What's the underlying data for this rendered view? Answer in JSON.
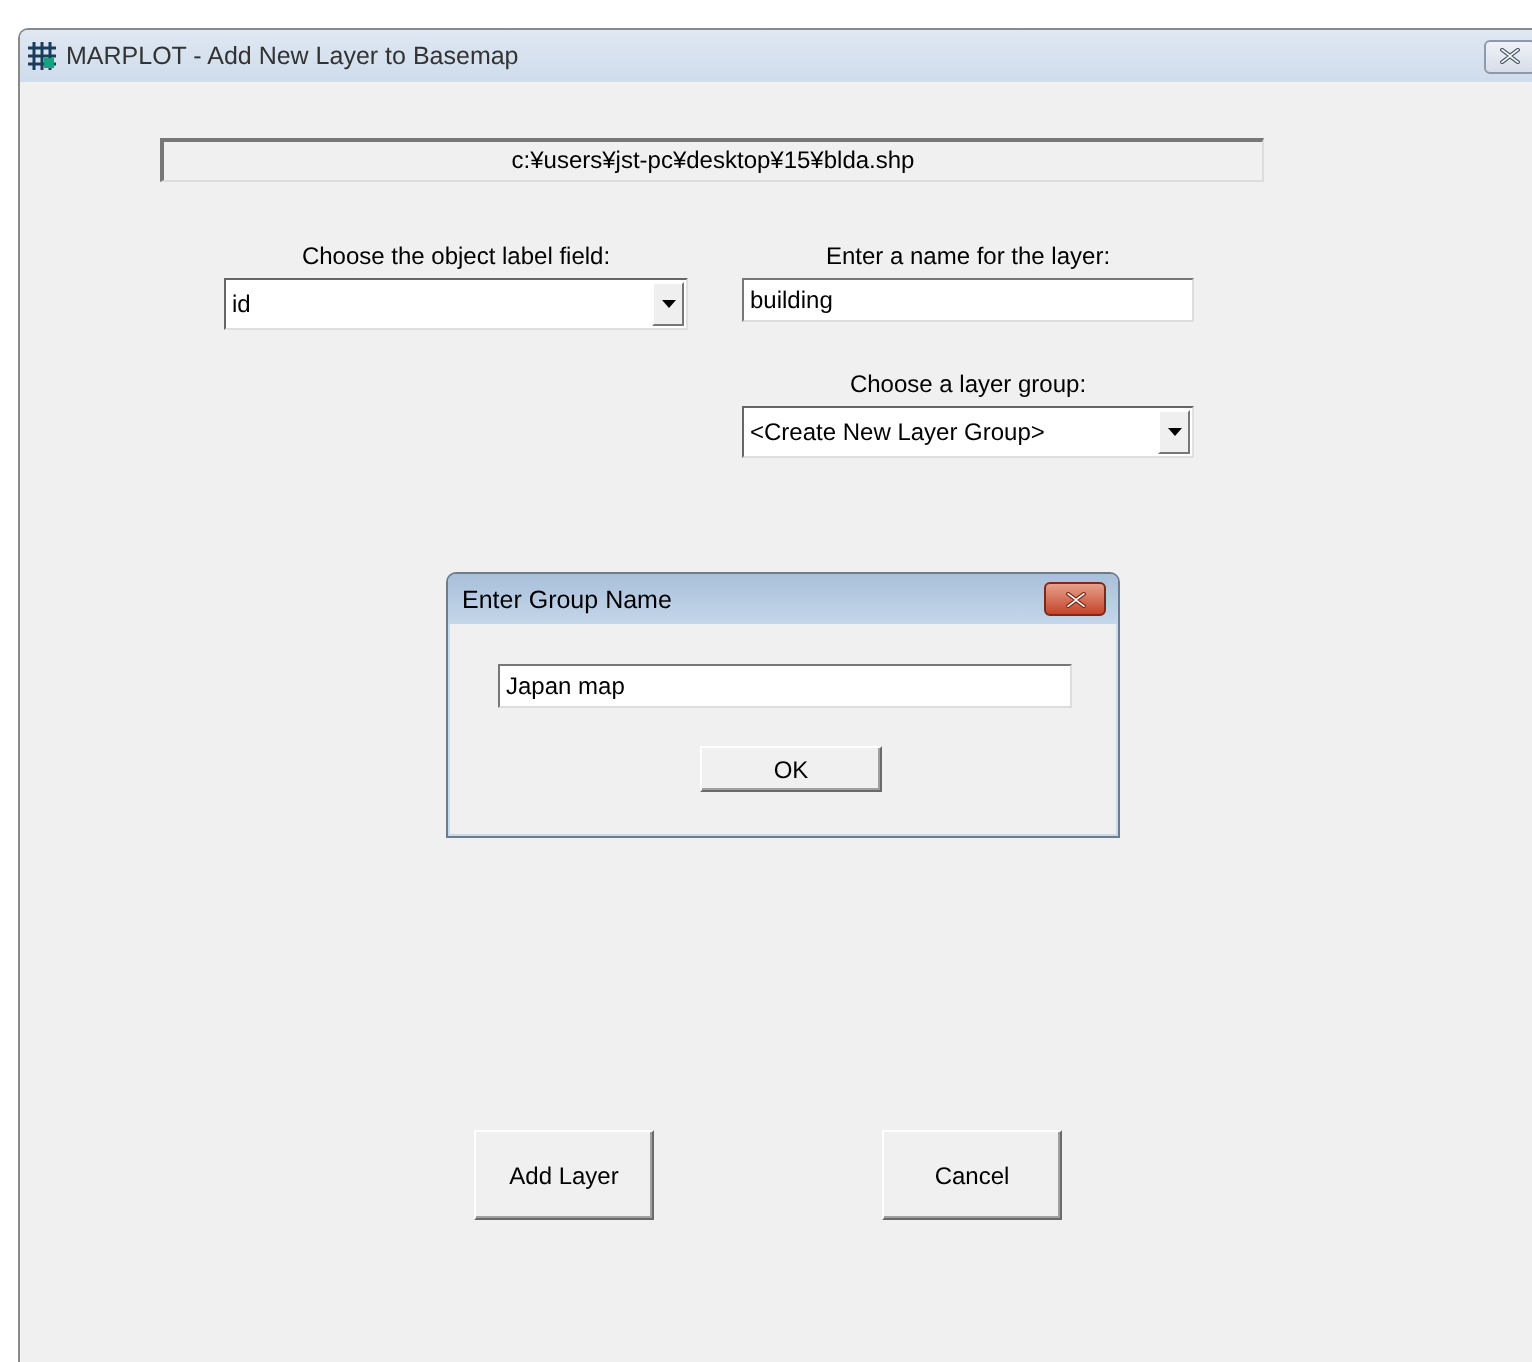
{
  "window": {
    "title": "MARPLOT - Add New Layer to Basemap"
  },
  "file_path": "c:¥users¥jst-pc¥desktop¥15¥blda.shp",
  "label_field": {
    "label": "Choose the object label field:",
    "value": "id"
  },
  "layer_name": {
    "label": "Enter a name for the layer:",
    "value": "building"
  },
  "layer_group": {
    "label": "Choose a layer group:",
    "value": "<Create New Layer Group>"
  },
  "buttons": [
    "Add Layer",
    "Cancel"
  ],
  "dialog": {
    "title": "Enter Group Name",
    "value": "Japan map",
    "buttons": [
      "OK"
    ]
  }
}
